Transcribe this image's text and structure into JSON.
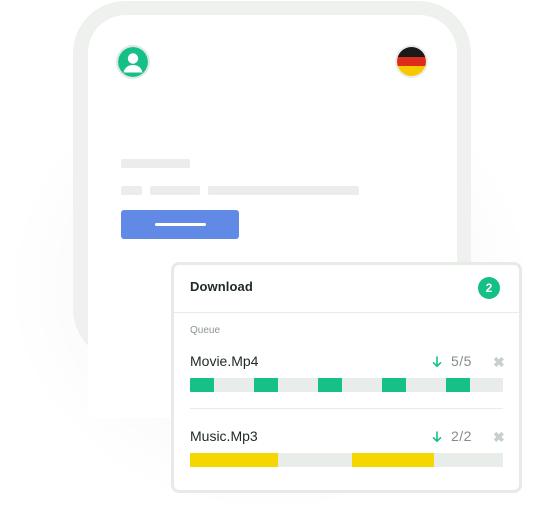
{
  "colors": {
    "accent_green": "#17c088",
    "accent_yellow": "#f4d600",
    "button_blue": "#6189e6"
  },
  "flag": {
    "icon": "germany-flag-icon",
    "colors": [
      "#1a1a1a",
      "#dd2b1c",
      "#f6c900"
    ]
  },
  "avatar": {
    "icon": "user-avatar-icon"
  },
  "download_panel": {
    "title": "Download",
    "badge": "2",
    "queue_label": "Queue",
    "items": [
      {
        "name": "Movie.Mp4",
        "progress": "5/5",
        "icon": "download-arrow-icon",
        "remove_icon": "close-icon",
        "color": "green",
        "segments_done": 5,
        "segments_total": 5
      },
      {
        "name": "Music.Mp3",
        "progress": "2/2",
        "icon": "download-arrow-icon",
        "remove_icon": "close-icon",
        "color": "yellow",
        "segments_done": 2,
        "segments_total": 2
      }
    ]
  }
}
